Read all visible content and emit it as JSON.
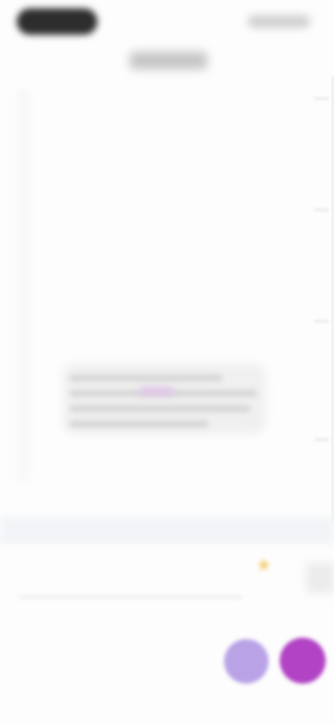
{
  "status_bar": {
    "time_icon": "status-pill",
    "indicators_icon": "status-indicators"
  },
  "header": {
    "title": ""
  },
  "content": {
    "card_text": ""
  },
  "composer": {
    "input_placeholder": "",
    "star_icon": "star-icon"
  },
  "actions": {
    "primary_icon": "assistant-icon",
    "secondary_icon": "compose-icon"
  },
  "colors": {
    "accent_light": "#b9a3e6",
    "accent_dark": "#b143c4",
    "star": "#f4d27a"
  }
}
